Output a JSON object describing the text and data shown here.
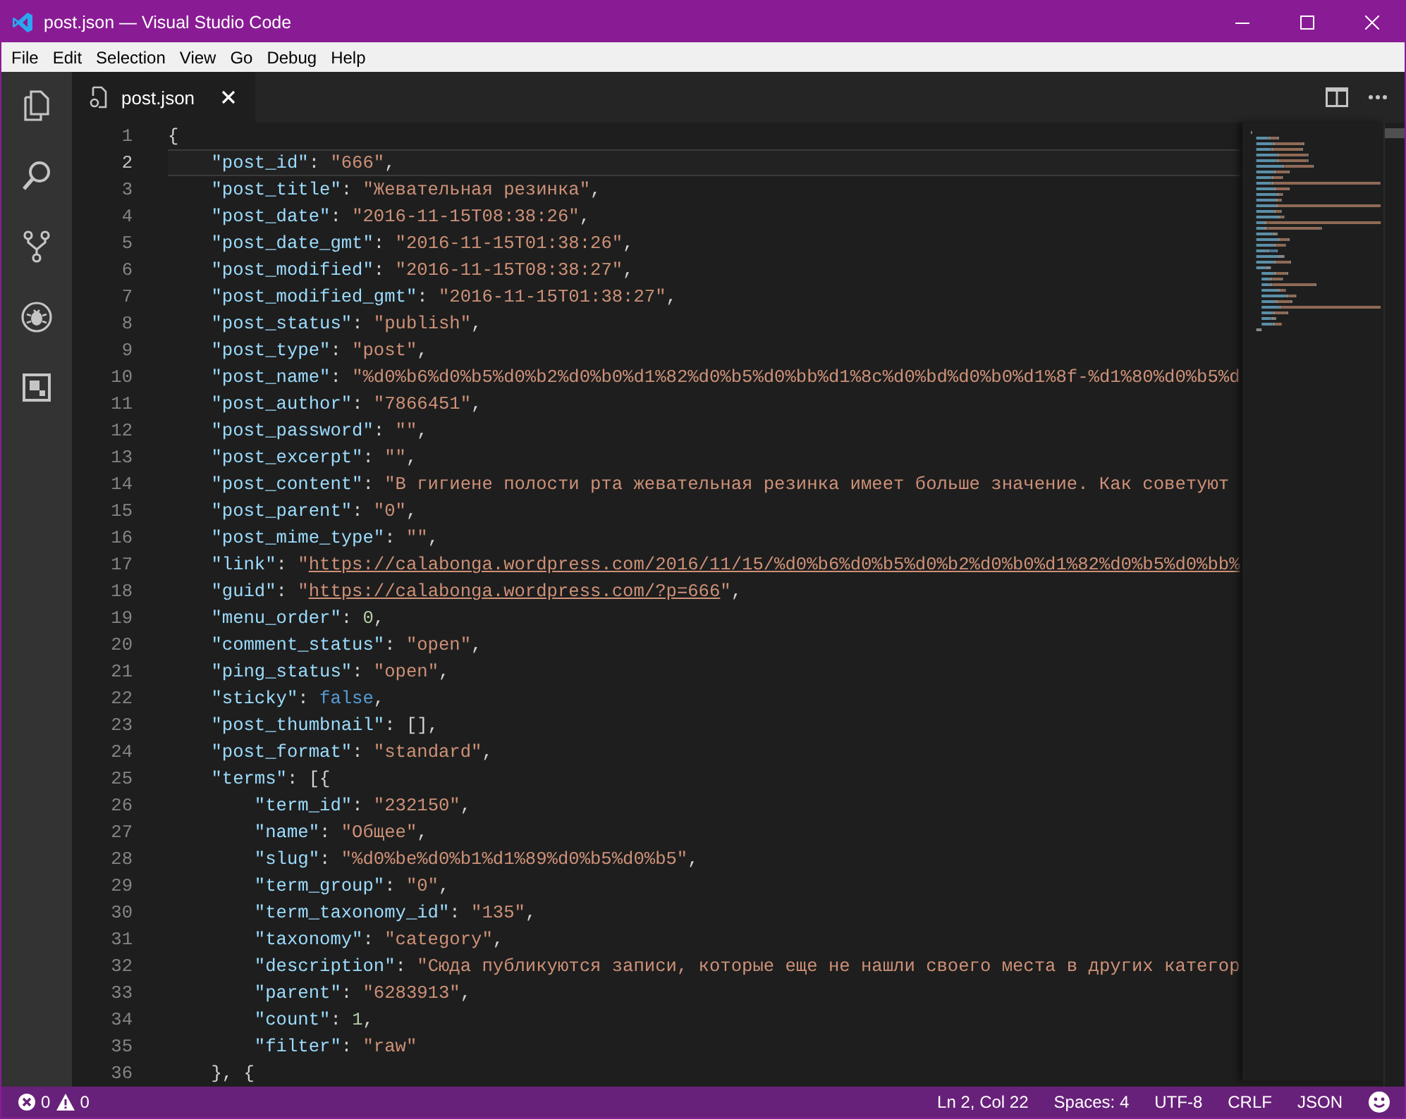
{
  "window": {
    "title": "post.json — Visual Studio Code"
  },
  "menu": [
    "File",
    "Edit",
    "Selection",
    "View",
    "Go",
    "Debug",
    "Help"
  ],
  "tabs": [
    {
      "label": "post.json",
      "selected": true
    }
  ],
  "editor": {
    "lines": [
      {
        "number": "1",
        "current": false,
        "tokens": [
          {
            "kind": "plain",
            "text": "{"
          }
        ]
      },
      {
        "number": "2",
        "current": true,
        "tokens": [
          {
            "kind": "key",
            "text": "    \"post_id\""
          },
          {
            "kind": "plain",
            "text": ": "
          },
          {
            "kind": "string",
            "text": "\"666\""
          },
          {
            "kind": "plain",
            "text": ","
          }
        ]
      },
      {
        "number": "3",
        "current": false,
        "tokens": [
          {
            "kind": "key",
            "text": "    \"post_title\""
          },
          {
            "kind": "plain",
            "text": ": "
          },
          {
            "kind": "string",
            "text": "\"Жевательная резинка\""
          },
          {
            "kind": "plain",
            "text": ","
          }
        ]
      },
      {
        "number": "4",
        "current": false,
        "tokens": [
          {
            "kind": "key",
            "text": "    \"post_date\""
          },
          {
            "kind": "plain",
            "text": ": "
          },
          {
            "kind": "string",
            "text": "\"2016-11-15T08:38:26\""
          },
          {
            "kind": "plain",
            "text": ","
          }
        ]
      },
      {
        "number": "5",
        "current": false,
        "tokens": [
          {
            "kind": "key",
            "text": "    \"post_date_gmt\""
          },
          {
            "kind": "plain",
            "text": ": "
          },
          {
            "kind": "string",
            "text": "\"2016-11-15T01:38:26\""
          },
          {
            "kind": "plain",
            "text": ","
          }
        ]
      },
      {
        "number": "6",
        "current": false,
        "tokens": [
          {
            "kind": "key",
            "text": "    \"post_modified\""
          },
          {
            "kind": "plain",
            "text": ": "
          },
          {
            "kind": "string",
            "text": "\"2016-11-15T08:38:27\""
          },
          {
            "kind": "plain",
            "text": ","
          }
        ]
      },
      {
        "number": "7",
        "current": false,
        "tokens": [
          {
            "kind": "key",
            "text": "    \"post_modified_gmt\""
          },
          {
            "kind": "plain",
            "text": ": "
          },
          {
            "kind": "string",
            "text": "\"2016-11-15T01:38:27\""
          },
          {
            "kind": "plain",
            "text": ","
          }
        ]
      },
      {
        "number": "8",
        "current": false,
        "tokens": [
          {
            "kind": "key",
            "text": "    \"post_status\""
          },
          {
            "kind": "plain",
            "text": ": "
          },
          {
            "kind": "string",
            "text": "\"publish\""
          },
          {
            "kind": "plain",
            "text": ","
          }
        ]
      },
      {
        "number": "9",
        "current": false,
        "tokens": [
          {
            "kind": "key",
            "text": "    \"post_type\""
          },
          {
            "kind": "plain",
            "text": ": "
          },
          {
            "kind": "string",
            "text": "\"post\""
          },
          {
            "kind": "plain",
            "text": ","
          }
        ]
      },
      {
        "number": "10",
        "current": false,
        "tokens": [
          {
            "kind": "key",
            "text": "    \"post_name\""
          },
          {
            "kind": "plain",
            "text": ": "
          },
          {
            "kind": "string",
            "text": "\"%d0%b6%d0%b5%d0%b2%d0%b0%d1%82%d0%b5%d0%bb%d1%8c%d0%bd%d0%b0%d1%8f-%d1%80%d0%b5%d"
          }
        ]
      },
      {
        "number": "11",
        "current": false,
        "tokens": [
          {
            "kind": "key",
            "text": "    \"post_author\""
          },
          {
            "kind": "plain",
            "text": ": "
          },
          {
            "kind": "string",
            "text": "\"7866451\""
          },
          {
            "kind": "plain",
            "text": ","
          }
        ]
      },
      {
        "number": "12",
        "current": false,
        "tokens": [
          {
            "kind": "key",
            "text": "    \"post_password\""
          },
          {
            "kind": "plain",
            "text": ": "
          },
          {
            "kind": "string",
            "text": "\"\""
          },
          {
            "kind": "plain",
            "text": ","
          }
        ]
      },
      {
        "number": "13",
        "current": false,
        "tokens": [
          {
            "kind": "key",
            "text": "    \"post_excerpt\""
          },
          {
            "kind": "plain",
            "text": ": "
          },
          {
            "kind": "string",
            "text": "\"\""
          },
          {
            "kind": "plain",
            "text": ","
          }
        ]
      },
      {
        "number": "14",
        "current": false,
        "tokens": [
          {
            "kind": "key",
            "text": "    \"post_content\""
          },
          {
            "kind": "plain",
            "text": ": "
          },
          {
            "kind": "string",
            "text": "\"В гигиене полости рта жевательная резинка имеет больше значение. Как советуют"
          }
        ]
      },
      {
        "number": "15",
        "current": false,
        "tokens": [
          {
            "kind": "key",
            "text": "    \"post_parent\""
          },
          {
            "kind": "plain",
            "text": ": "
          },
          {
            "kind": "string",
            "text": "\"0\""
          },
          {
            "kind": "plain",
            "text": ","
          }
        ]
      },
      {
        "number": "16",
        "current": false,
        "tokens": [
          {
            "kind": "key",
            "text": "    \"post_mime_type\""
          },
          {
            "kind": "plain",
            "text": ": "
          },
          {
            "kind": "string",
            "text": "\"\""
          },
          {
            "kind": "plain",
            "text": ","
          }
        ]
      },
      {
        "number": "17",
        "current": false,
        "tokens": [
          {
            "kind": "key",
            "text": "    \"link\""
          },
          {
            "kind": "plain",
            "text": ": "
          },
          {
            "kind": "string",
            "text": "\""
          },
          {
            "kind": "link",
            "text": "https://calabonga.wordpress.com/2016/11/15/%d0%b6%d0%b5%d0%b2%d0%b0%d1%82%d0%b5%d0%bb%"
          }
        ]
      },
      {
        "number": "18",
        "current": false,
        "tokens": [
          {
            "kind": "key",
            "text": "    \"guid\""
          },
          {
            "kind": "plain",
            "text": ": "
          },
          {
            "kind": "string",
            "text": "\""
          },
          {
            "kind": "link",
            "text": "https://calabonga.wordpress.com/?p=666"
          },
          {
            "kind": "string",
            "text": "\""
          },
          {
            "kind": "plain",
            "text": ","
          }
        ]
      },
      {
        "number": "19",
        "current": false,
        "tokens": [
          {
            "kind": "key",
            "text": "    \"menu_order\""
          },
          {
            "kind": "plain",
            "text": ": "
          },
          {
            "kind": "number",
            "text": "0"
          },
          {
            "kind": "plain",
            "text": ","
          }
        ]
      },
      {
        "number": "20",
        "current": false,
        "tokens": [
          {
            "kind": "key",
            "text": "    \"comment_status\""
          },
          {
            "kind": "plain",
            "text": ": "
          },
          {
            "kind": "string",
            "text": "\"open\""
          },
          {
            "kind": "plain",
            "text": ","
          }
        ]
      },
      {
        "number": "21",
        "current": false,
        "tokens": [
          {
            "kind": "key",
            "text": "    \"ping_status\""
          },
          {
            "kind": "plain",
            "text": ": "
          },
          {
            "kind": "string",
            "text": "\"open\""
          },
          {
            "kind": "plain",
            "text": ","
          }
        ]
      },
      {
        "number": "22",
        "current": false,
        "tokens": [
          {
            "kind": "key",
            "text": "    \"sticky\""
          },
          {
            "kind": "plain",
            "text": ": "
          },
          {
            "kind": "keyword",
            "text": "false"
          },
          {
            "kind": "plain",
            "text": ","
          }
        ]
      },
      {
        "number": "23",
        "current": false,
        "tokens": [
          {
            "kind": "key",
            "text": "    \"post_thumbnail\""
          },
          {
            "kind": "plain",
            "text": ": [],"
          }
        ]
      },
      {
        "number": "24",
        "current": false,
        "tokens": [
          {
            "kind": "key",
            "text": "    \"post_format\""
          },
          {
            "kind": "plain",
            "text": ": "
          },
          {
            "kind": "string",
            "text": "\"standard\""
          },
          {
            "kind": "plain",
            "text": ","
          }
        ]
      },
      {
        "number": "25",
        "current": false,
        "tokens": [
          {
            "kind": "key",
            "text": "    \"terms\""
          },
          {
            "kind": "plain",
            "text": ": [{"
          }
        ]
      },
      {
        "number": "26",
        "current": false,
        "tokens": [
          {
            "kind": "key",
            "text": "        \"term_id\""
          },
          {
            "kind": "plain",
            "text": ": "
          },
          {
            "kind": "string",
            "text": "\"232150\""
          },
          {
            "kind": "plain",
            "text": ","
          }
        ]
      },
      {
        "number": "27",
        "current": false,
        "tokens": [
          {
            "kind": "key",
            "text": "        \"name\""
          },
          {
            "kind": "plain",
            "text": ": "
          },
          {
            "kind": "string",
            "text": "\"Общее\""
          },
          {
            "kind": "plain",
            "text": ","
          }
        ]
      },
      {
        "number": "28",
        "current": false,
        "tokens": [
          {
            "kind": "key",
            "text": "        \"slug\""
          },
          {
            "kind": "plain",
            "text": ": "
          },
          {
            "kind": "string",
            "text": "\"%d0%be%d0%b1%d1%89%d0%b5%d0%b5\""
          },
          {
            "kind": "plain",
            "text": ","
          }
        ]
      },
      {
        "number": "29",
        "current": false,
        "tokens": [
          {
            "kind": "key",
            "text": "        \"term_group\""
          },
          {
            "kind": "plain",
            "text": ": "
          },
          {
            "kind": "string",
            "text": "\"0\""
          },
          {
            "kind": "plain",
            "text": ","
          }
        ]
      },
      {
        "number": "30",
        "current": false,
        "tokens": [
          {
            "kind": "key",
            "text": "        \"term_taxonomy_id\""
          },
          {
            "kind": "plain",
            "text": ": "
          },
          {
            "kind": "string",
            "text": "\"135\""
          },
          {
            "kind": "plain",
            "text": ","
          }
        ]
      },
      {
        "number": "31",
        "current": false,
        "tokens": [
          {
            "kind": "key",
            "text": "        \"taxonomy\""
          },
          {
            "kind": "plain",
            "text": ": "
          },
          {
            "kind": "string",
            "text": "\"category\""
          },
          {
            "kind": "plain",
            "text": ","
          }
        ]
      },
      {
        "number": "32",
        "current": false,
        "tokens": [
          {
            "kind": "key",
            "text": "        \"description\""
          },
          {
            "kind": "plain",
            "text": ": "
          },
          {
            "kind": "string",
            "text": "\"Сюда публикуются записи, которые еще не нашли своего места в других категор"
          }
        ]
      },
      {
        "number": "33",
        "current": false,
        "tokens": [
          {
            "kind": "key",
            "text": "        \"parent\""
          },
          {
            "kind": "plain",
            "text": ": "
          },
          {
            "kind": "string",
            "text": "\"6283913\""
          },
          {
            "kind": "plain",
            "text": ","
          }
        ]
      },
      {
        "number": "34",
        "current": false,
        "tokens": [
          {
            "kind": "key",
            "text": "        \"count\""
          },
          {
            "kind": "plain",
            "text": ": "
          },
          {
            "kind": "number",
            "text": "1"
          },
          {
            "kind": "plain",
            "text": ","
          }
        ]
      },
      {
        "number": "35",
        "current": false,
        "tokens": [
          {
            "kind": "key",
            "text": "        \"filter\""
          },
          {
            "kind": "plain",
            "text": ": "
          },
          {
            "kind": "string",
            "text": "\"raw\""
          }
        ]
      },
      {
        "number": "36",
        "current": false,
        "tokens": [
          {
            "kind": "plain",
            "text": "    }, {"
          }
        ]
      }
    ]
  },
  "status_bar": {
    "errors": "0",
    "warnings": "0",
    "items": [
      "Ln 2, Col 22",
      "Spaces: 4",
      "UTF-8",
      "CRLF",
      "JSON"
    ]
  }
}
